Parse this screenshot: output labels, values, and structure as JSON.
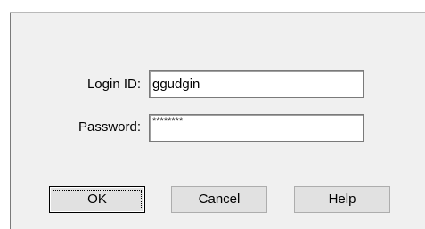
{
  "form": {
    "login_label": "Login ID:",
    "login_value": "ggudgin",
    "password_label": "Password:",
    "password_mask": "********"
  },
  "buttons": {
    "ok_label": "OK",
    "cancel_label": "Cancel",
    "help_label": "Help"
  },
  "colors": {
    "panel_bg": "#f0f0f0",
    "button_bg": "#e1e1e1",
    "field_border": "#7a7a7a"
  }
}
